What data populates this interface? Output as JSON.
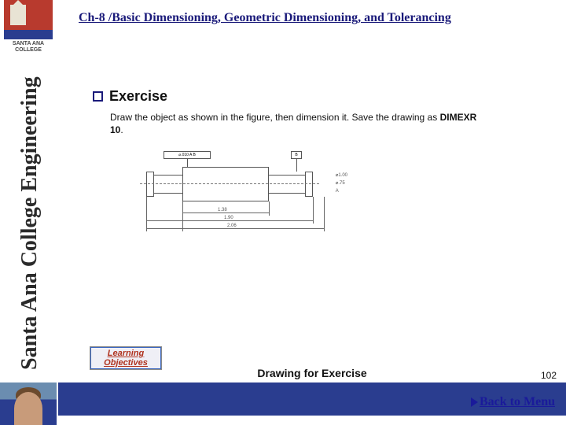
{
  "header": {
    "title": "Ch-8 /Basic Dimensioning, Geometric Dimensioning, and Tolerancing"
  },
  "sidebar": {
    "logo_text": "SANTA ANA COLLEGE",
    "vertical_title": "Santa Ana College Engineering"
  },
  "exercise": {
    "heading": "Exercise",
    "body_prefix": "Draw the object as shown in the figure, then dimension it. Save the drawing as ",
    "body_bold": "DIMEXR 10",
    "body_suffix": "."
  },
  "figure": {
    "gdt_callout": "⌀.010 A B",
    "datum_b": "B",
    "dim_mid": "1.38",
    "dim_overall1": "1.90",
    "dim_overall2": "2.06",
    "dia1": "⌀1.00",
    "dia2": "⌀.75",
    "datum_a": "A"
  },
  "learning_objectives": {
    "label": "Learning Objectives"
  },
  "footer": {
    "caption": "Drawing for Exercise",
    "page_number": "102",
    "back_link": "Back to Menu"
  }
}
